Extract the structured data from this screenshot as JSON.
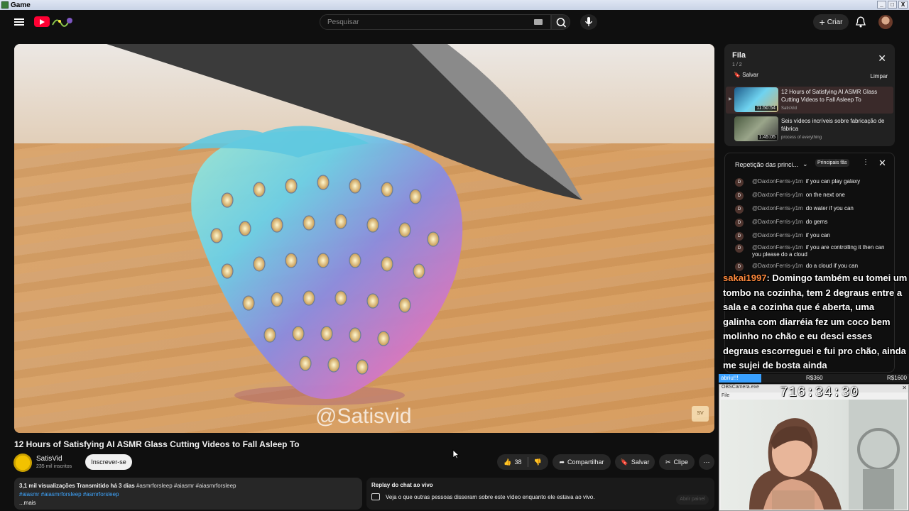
{
  "window": {
    "title": "Game",
    "buttons": [
      "_",
      "□",
      "X"
    ]
  },
  "header": {
    "search_placeholder": "Pesquisar",
    "create_label": "Criar"
  },
  "video": {
    "watermark": "@Satisvid",
    "corner_badge": "SV",
    "title": "12 Hours of Satisfying AI ASMR Glass Cutting Videos to Fall Asleep To",
    "channel": "SatisVid",
    "subscribers": "235 mil inscritos",
    "subscribe_label": "Inscrever-se",
    "likes": "38",
    "share_label": "Compartilhar",
    "save_label": "Salvar",
    "clip_label": "Clipe"
  },
  "description": {
    "stats": "3,1 mil visualizações  Transmitido há 3 dias",
    "tags_line1": "#asmrforsleep #aiasmr #aiasmrforsleep",
    "tags_line2": "#aiasmr #aiasmrforsleep #asmrforsleep",
    "more": "...mais"
  },
  "chat_replay": {
    "title": "Replay do chat ao vivo",
    "text": "Veja o que outras pessoas disseram sobre este vídeo enquanto ele estava ao vivo.",
    "open_label": "Abrir painel"
  },
  "queue": {
    "title": "Fila",
    "count": "1 / 2",
    "save_label": "Salvar",
    "clear_label": "Limpar",
    "items": [
      {
        "title": "12 Hours of Satisfying AI ASMR Glass Cutting Videos to Fall Asleep To",
        "channel": "SatisVid",
        "duration": "11:50:54"
      },
      {
        "title": "Seis vídeos incríveis sobre fabricação de fábrica",
        "channel": "process of everything",
        "duration": "1:45:05"
      }
    ]
  },
  "chat": {
    "header": "Repetição das princi...",
    "fans_label": "Principais fãs",
    "messages": [
      {
        "author": "@DaxtonFerris-y1m",
        "text": "if you can play galaxy",
        "avatar": "D"
      },
      {
        "author": "@DaxtonFerris-y1m",
        "text": "on the next one",
        "avatar": "D"
      },
      {
        "author": "@DaxtonFerris-y1m",
        "text": "do water if you can",
        "avatar": "D"
      },
      {
        "author": "@DaxtonFerris-y1m",
        "text": "do gems",
        "avatar": "D"
      },
      {
        "author": "@DaxtonFerris-y1m",
        "text": "if you can",
        "avatar": "D"
      },
      {
        "author": "@DaxtonFerris-y1m",
        "text": "if you are controlling it then can you please do a cloud",
        "avatar": "D"
      },
      {
        "author": "@DaxtonFerris-y1m",
        "text": "do a cloud if you can",
        "avatar": "D"
      }
    ]
  },
  "overlay": {
    "user": "sakai1997",
    "message": ": Domingo também eu tomei um tombo na cozinha, tem 2 degraus entre a sala e a cozinha que é aberta, uma galinha com diarréia fez um coco bem molinho no chão e eu desci esses degraus escorreguei e fui pro chão, ainda me sujei de bosta ainda"
  },
  "goal": {
    "label": "abriu!!!",
    "mid": "R$360",
    "end": "R$1600",
    "progress": 0.225
  },
  "camera": {
    "window_title": "OBSCamera.exe",
    "menu": "File",
    "timer": "716:34:30"
  },
  "colors": {
    "accent": "#ff0033",
    "link": "#3ea6ff",
    "overlay_user": "#ff8a3d",
    "goal_fill": "#39a0ff"
  }
}
